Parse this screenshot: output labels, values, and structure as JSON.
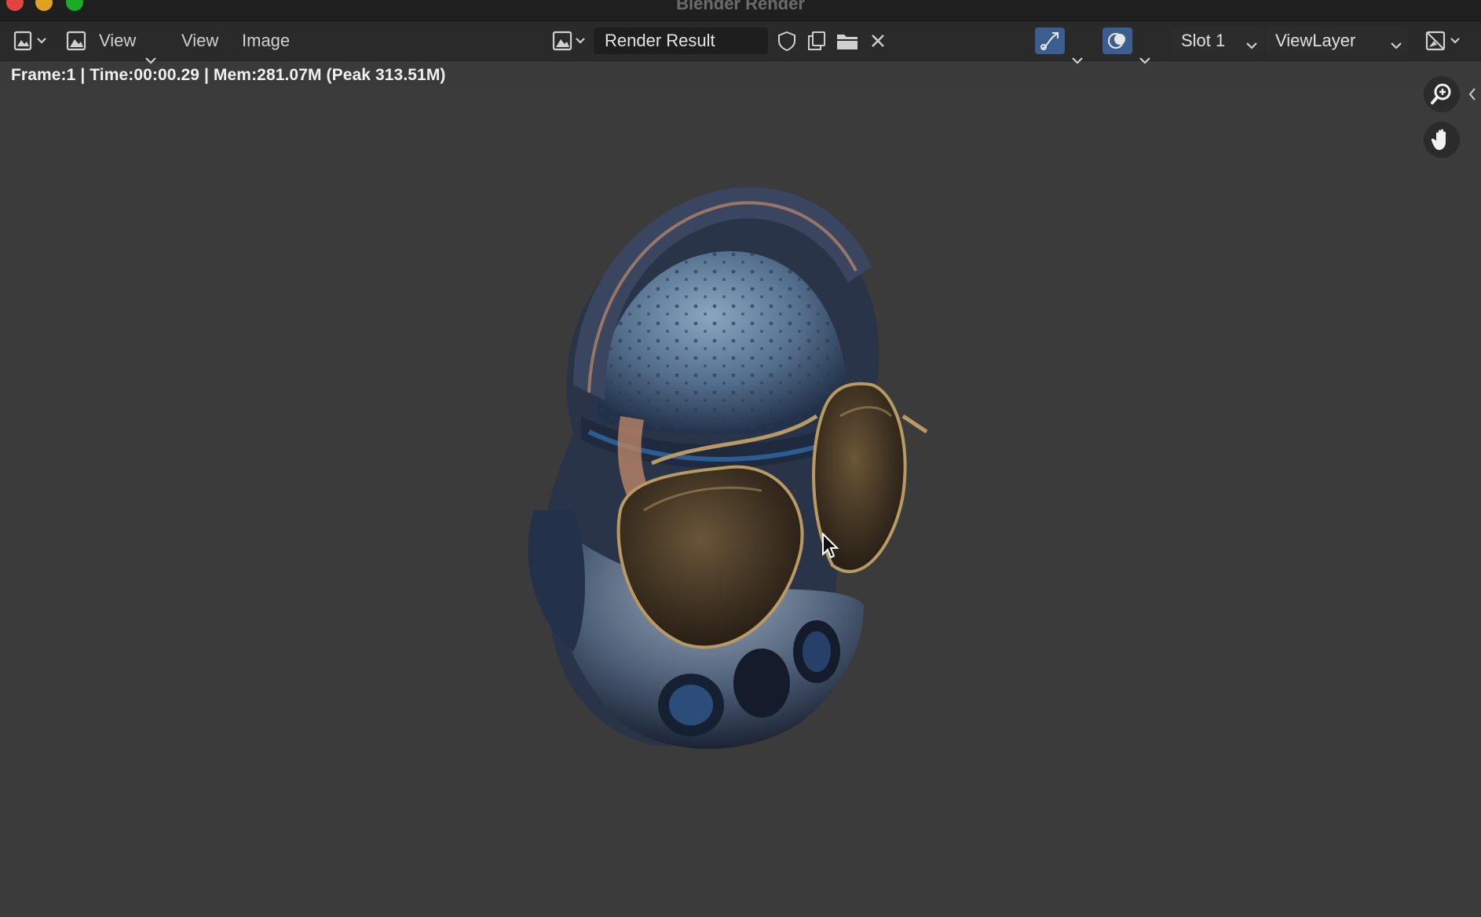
{
  "window": {
    "title": "Blender Render"
  },
  "header": {
    "editor_type_icon": "image-editor-icon",
    "view_mode_label": "View",
    "menus": [
      "View",
      "Image"
    ],
    "image_name": "Render Result",
    "slot": "Slot 1",
    "view_layer": "ViewLayer"
  },
  "status": {
    "text": "Frame:1 | Time:00:00.29 | Mem:281.07M (Peak 313.51M)"
  },
  "navigation": {
    "zoom_icon": "zoom-icon",
    "pan_icon": "hand-icon"
  }
}
